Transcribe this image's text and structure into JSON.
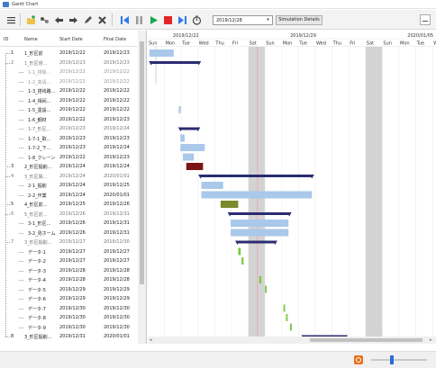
{
  "window": {
    "title": "Gantt Chart"
  },
  "toolbar": {
    "date_value": "2019/12/28",
    "simulation_label": "Simulation Details"
  },
  "grid": {
    "headers": {
      "id": "ID",
      "name": "Name",
      "start": "Start Date",
      "finish": "Final Date"
    },
    "rows": [
      {
        "id": "1",
        "name": "1_形区前",
        "start": "2019/12/22",
        "finish": "2019/12/23",
        "style": "normal"
      },
      {
        "id": "2",
        "name": "1_形区塔...",
        "start": "2019/12/23",
        "finish": "2019/12/23",
        "style": "gray"
      },
      {
        "id": "",
        "name": "1-1_排除...",
        "start": "2019/12/22",
        "finish": "2019/12/22",
        "style": "light"
      },
      {
        "id": "",
        "name": "1-2_高清...",
        "start": "2019/12/22",
        "finish": "2019/12/22",
        "style": "light"
      },
      {
        "id": "",
        "name": "1-3_搭线路...",
        "start": "2019/12/22",
        "finish": "2019/12/22",
        "style": "normal"
      },
      {
        "id": "",
        "name": "1-4_相间...",
        "start": "2019/12/22",
        "finish": "2019/12/22",
        "style": "normal"
      },
      {
        "id": "",
        "name": "1-5_墨設...",
        "start": "2019/12/22",
        "finish": "2019/12/22",
        "style": "normal"
      },
      {
        "id": "",
        "name": "1-6_鋼材",
        "start": "2019/12/22",
        "finish": "2019/12/23",
        "style": "normal"
      },
      {
        "id": "",
        "name": "1-7_形区...",
        "start": "2019/12/23",
        "finish": "2019/12/24",
        "style": "gray"
      },
      {
        "id": "",
        "name": "1-7-1_取...",
        "start": "2019/12/23",
        "finish": "2019/12/23",
        "style": "normal"
      },
      {
        "id": "",
        "name": "1-7-2_下...",
        "start": "2019/12/23",
        "finish": "2019/12/24",
        "style": "normal"
      },
      {
        "id": "",
        "name": "1-8_クレーン",
        "start": "2019/12/22",
        "finish": "2019/12/23",
        "style": "normal"
      },
      {
        "id": "3",
        "name": "2_形区掘削...",
        "start": "2019/12/24",
        "finish": "2019/12/24",
        "style": "normal"
      },
      {
        "id": "4",
        "name": "3_形区陽...",
        "start": "2019/12/24",
        "finish": "2020/01/01",
        "style": "gray"
      },
      {
        "id": "",
        "name": "2-1_掘削",
        "start": "2019/12/24",
        "finish": "2019/12/25",
        "style": "normal"
      },
      {
        "id": "",
        "name": "2-2_作業",
        "start": "2019/12/24",
        "finish": "2020/01/01",
        "style": "normal"
      },
      {
        "id": "5",
        "name": "4_形区前...",
        "start": "2019/12/25",
        "finish": "2019/12/26",
        "style": "normal"
      },
      {
        "id": "6",
        "name": "5_形区前...",
        "start": "2019/12/26",
        "finish": "2019/12/31",
        "style": "gray"
      },
      {
        "id": "",
        "name": "3-1_形区...",
        "start": "2019/12/26",
        "finish": "2019/12/31",
        "style": "normal"
      },
      {
        "id": "",
        "name": "3-2_見ホーム",
        "start": "2019/12/26",
        "finish": "2019/12/31",
        "style": "normal"
      },
      {
        "id": "7",
        "name": "3_形区掘削...",
        "start": "2019/12/27",
        "finish": "2019/12/30",
        "style": "gray"
      },
      {
        "id": "",
        "name": "データ-1",
        "start": "2019/12/27",
        "finish": "2019/12/27",
        "style": "normal"
      },
      {
        "id": "",
        "name": "データ-2",
        "start": "2019/12/27",
        "finish": "2019/12/27",
        "style": "normal"
      },
      {
        "id": "",
        "name": "データ-3",
        "start": "2019/12/28",
        "finish": "2019/12/28",
        "style": "normal"
      },
      {
        "id": "",
        "name": "データ-4",
        "start": "2019/12/28",
        "finish": "2019/12/28",
        "style": "normal"
      },
      {
        "id": "",
        "name": "データ-5",
        "start": "2019/12/29",
        "finish": "2019/12/29",
        "style": "normal"
      },
      {
        "id": "",
        "name": "データ-6",
        "start": "2019/12/29",
        "finish": "2019/12/29",
        "style": "normal"
      },
      {
        "id": "",
        "name": "データ-7",
        "start": "2019/12/30",
        "finish": "2019/12/30",
        "style": "normal"
      },
      {
        "id": "",
        "name": "データ-8",
        "start": "2019/12/30",
        "finish": "2019/12/30",
        "style": "normal"
      },
      {
        "id": "",
        "name": "データ-9",
        "start": "2019/12/30",
        "finish": "2019/12/30",
        "style": "normal"
      },
      {
        "id": "8",
        "name": "3_形区掘削...",
        "start": "2019/12/31",
        "finish": "2020/01/01",
        "style": "normal"
      }
    ]
  },
  "chart": {
    "weeks": [
      "2019/12/22",
      "2019/12/29",
      "2020/01/05"
    ],
    "days": [
      "Sun",
      "Mon",
      "Tue",
      "Wed",
      "Thu",
      "Fri",
      "Sat",
      "Sun",
      "Mon",
      "Tue",
      "Wed",
      "Thu",
      "Fri",
      "Sat",
      "Sun",
      "Mon",
      "Tue",
      "Wed",
      "Thu",
      "Fri",
      "Sat",
      "Sun",
      "Mon"
    ],
    "weekend_day_indexes": [
      6,
      13,
      20
    ],
    "today_day_index": 6.55,
    "colors": {
      "summary": "#2b2c72",
      "task": "#a9c8ea",
      "critical": "#7b1414",
      "olive": "#7a8a2b",
      "milestone": "#7ac943",
      "weekend": "#d3d3d3",
      "today": "#f0a0b0"
    },
    "bars": [
      {
        "row": 0,
        "type": "task",
        "start": 0.1,
        "end": 1.55
      },
      {
        "row": 1,
        "type": "summary",
        "start": 0.2,
        "end": 3.05
      },
      {
        "row": 6,
        "type": "task",
        "start": 1.85,
        "end": 1.97
      },
      {
        "row": 8,
        "type": "summary",
        "start": 1.95,
        "end": 3.0
      },
      {
        "row": 9,
        "type": "task",
        "start": 1.95,
        "end": 2.2
      },
      {
        "row": 10,
        "type": "task",
        "start": 1.95,
        "end": 3.4
      },
      {
        "row": 11,
        "type": "task",
        "start": 2.1,
        "end": 2.75
      },
      {
        "row": 12,
        "type": "critical",
        "start": 2.3,
        "end": 3.3
      },
      {
        "row": 13,
        "type": "summary",
        "start": 3.15,
        "end": 9.8
      },
      {
        "row": 14,
        "type": "task",
        "start": 3.2,
        "end": 4.5
      },
      {
        "row": 15,
        "type": "task",
        "start": 3.2,
        "end": 9.8
      },
      {
        "row": 16,
        "type": "olive",
        "start": 4.35,
        "end": 5.4
      },
      {
        "row": 17,
        "type": "summary",
        "start": 4.9,
        "end": 8.45
      },
      {
        "row": 18,
        "type": "task",
        "start": 4.95,
        "end": 8.4
      },
      {
        "row": 19,
        "type": "task",
        "start": 4.95,
        "end": 8.4
      },
      {
        "row": 20,
        "type": "summary",
        "start": 5.35,
        "end": 7.6
      },
      {
        "row": 21,
        "type": "milestone",
        "start": 5.4,
        "end": 5.55
      },
      {
        "row": 22,
        "type": "milestone",
        "start": 5.6,
        "end": 5.72
      },
      {
        "row": 24,
        "type": "milestone",
        "start": 6.65,
        "end": 6.78
      },
      {
        "row": 25,
        "type": "milestone",
        "start": 7.0,
        "end": 7.1
      },
      {
        "row": 27,
        "type": "milestone",
        "start": 8.1,
        "end": 8.2
      },
      {
        "row": 28,
        "type": "milestone",
        "start": 8.25,
        "end": 8.35
      },
      {
        "row": 29,
        "type": "milestone",
        "start": 8.5,
        "end": 8.6
      },
      {
        "row": 30,
        "type": "summary",
        "start": 9.3,
        "end": 11.8
      }
    ]
  }
}
